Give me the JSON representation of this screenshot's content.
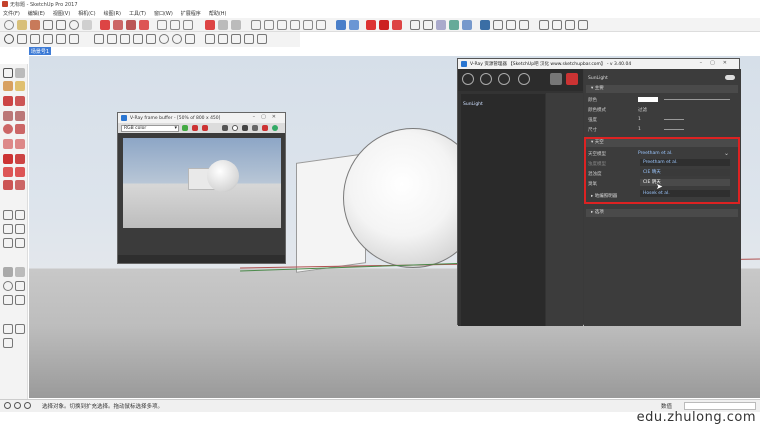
{
  "app": {
    "title": "无标题 - SketchUp Pro 2017"
  },
  "menu": [
    "文件(F)",
    "编辑(E)",
    "视图(V)",
    "相机(C)",
    "绘图(R)",
    "工具(T)",
    "窗口(W)",
    "扩展程序",
    "帮助(H)"
  ],
  "scene_tab": "场景号1",
  "vfb": {
    "title": "V-Ray frame buffer - [50% of 800 x 450]",
    "channel": "RGB color"
  },
  "asset_editor": {
    "title": "V-Ray 资源管理器 【SketchUp吧 汉化 www.sketchupbar.com】 - v 3.40.04",
    "list_item": "SunLight",
    "panel_title": "SunLight",
    "sections": {
      "main": "主要",
      "sky": "天空",
      "horizon": "地编照明器",
      "options": "选项"
    },
    "main_rows": [
      {
        "label": "颜色",
        "value": ""
      },
      {
        "label": "颜色模式",
        "value": "过滤"
      },
      {
        "label": "强度",
        "value": "1"
      },
      {
        "label": "尺寸",
        "value": "1"
      }
    ],
    "sky_rows": [
      {
        "label": "天空模型",
        "value": "Preetham et al."
      },
      {
        "label": "浊度模型",
        "value": "Preetham et al."
      },
      {
        "label": "混浊度",
        "value": "CIE 晴天"
      },
      {
        "label": "臭氧",
        "value": "CIE 阴天"
      }
    ],
    "dropdown_option": "Hosek et al."
  },
  "status": {
    "text": "选择对象。切换到扩充选择。拖动鼠标选择多项。",
    "measure_label": "数值"
  },
  "watermark": "edu.zhulong.com"
}
